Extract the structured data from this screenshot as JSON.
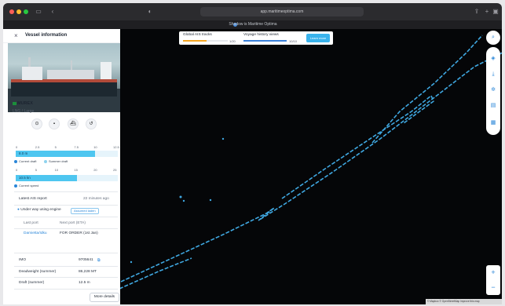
{
  "browser": {
    "url": "app.maritimeoptima.com",
    "tab_title": "Shadow is Maritime Optima",
    "icons": [
      "sidebar-icon",
      "back-icon",
      "shield-icon",
      "share-icon",
      "new-tab-icon",
      "tabs-icon"
    ]
  },
  "panel": {
    "title": "Vessel information",
    "close_label": "×",
    "vessel_name": "MUREX",
    "vessel_type": "LNG / Large",
    "actions": [
      "target-icon",
      "note-icon",
      "ship-icon",
      "history-icon"
    ],
    "draft_scale": [
      "0",
      "2.5",
      "5",
      "7.5",
      "10",
      "12.5"
    ],
    "draft_bar_label": "8.0 m",
    "draft_fraction": 0.78,
    "legend_current_draft": "Current draft",
    "legend_summer_draft": "Summer draft",
    "speed_scale": [
      "0",
      "5",
      "10",
      "15",
      "20",
      "25"
    ],
    "speed_bar_label": "10.5 kn",
    "speed_fraction": 0.6,
    "legend_current_speed": "Current speed",
    "latest_report_label": "Latest AIS report",
    "latest_report_value": "22 minutes ago",
    "status_text": "Under way using engine",
    "status_badge": "Assumed laden",
    "last_port_label": "Last port",
    "next_port_label": "Next port (ETA)",
    "last_port_value": "Damietta/Idku",
    "next_port_value": "FOR ORDER (1st Jan)",
    "imo_label": "IMO",
    "imo_value": "9705641",
    "deadweight_label": "Deadweight (summer)",
    "deadweight_value": "86,228 MT",
    "draft_label": "Draft (summer)",
    "draft_value": "12.5 m",
    "more_details": "More details"
  },
  "top_card": {
    "global_label": "Global AIS tracks",
    "global_count": "1/20",
    "voyage_label": "Voyage history views",
    "voyage_count": "10/10",
    "learn_label": "Learn more"
  },
  "toolbar": {
    "search_icon": "search-icon",
    "tools": [
      "layers-icon",
      "download-icon",
      "settings-icon",
      "ship-list-icon",
      "grid-icon"
    ],
    "zoom_in": "+",
    "zoom_out": "−"
  },
  "attribution": "© Mapbox © OpenStreetMap Improve this map",
  "colors": {
    "accent": "#3ab3ec",
    "track": "#3fa7e0",
    "global_bar": "#f5a623",
    "map_bg": "#050608"
  }
}
